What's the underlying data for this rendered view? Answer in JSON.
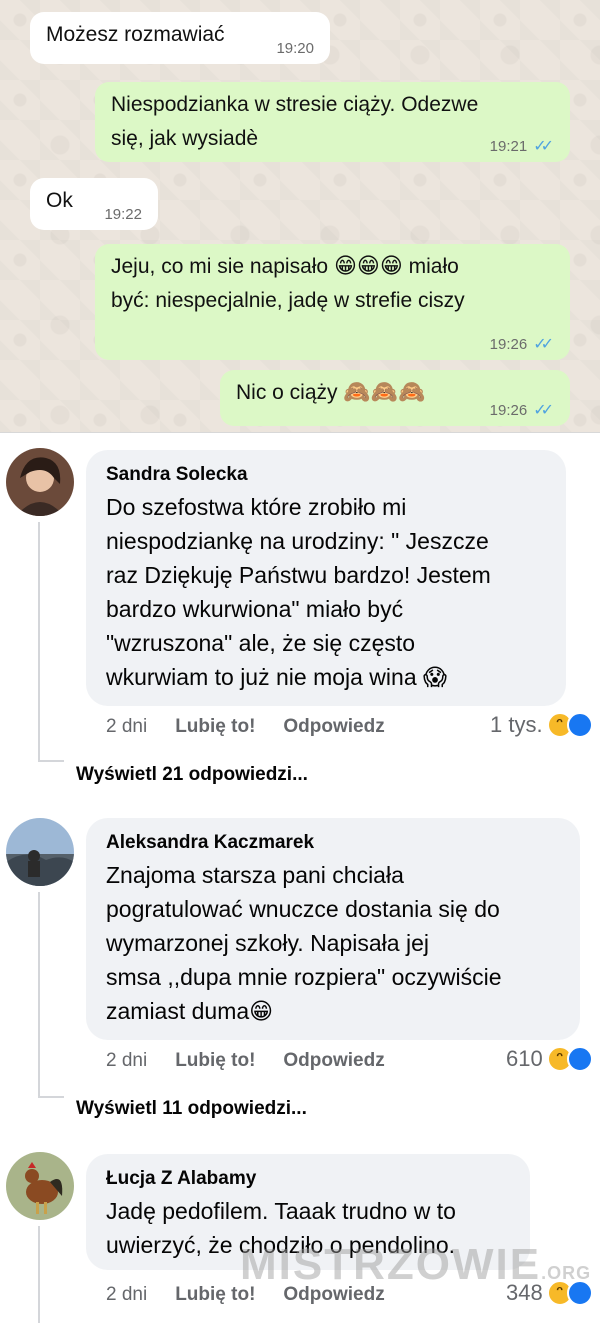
{
  "chat": {
    "messages": [
      {
        "text": "Możesz rozmawiać",
        "time": "19:20",
        "dir": "in"
      },
      {
        "text_line1": "Niespodzianka w stresie ciąży. Odezwe",
        "text_line2": "się, jak wysiadè",
        "time": "19:21",
        "dir": "out"
      },
      {
        "text": "Ok",
        "time": "19:22",
        "dir": "in"
      },
      {
        "text_line1a": "Jeju, co mi sie napisało",
        "emoji1": "😁😁😁",
        "text_line1b": "miało",
        "text_line2": "być: niespecjalnie, jadę w strefie ciszy",
        "time": "19:26",
        "dir": "out"
      },
      {
        "text": "Nic o ciąży",
        "emoji": "🙈🙈🙈",
        "time": "19:26",
        "dir": "out"
      }
    ],
    "read_ticks": "✓✓"
  },
  "comments": [
    {
      "name": "Sandra Solecka",
      "lines": [
        "Do szefostwa które zrobiło mi",
        "niespodziankę na urodziny: \" Jeszcze",
        "raz Dziękuję Państwu bardzo! Jestem",
        "bardzo wkurwiona\" miało być",
        "\"wzruszona\" ale, że się często",
        "wkurwiam to już nie moja wina 😱"
      ],
      "age": "2 dni",
      "like": "Lubię to!",
      "reply": "Odpowiedz",
      "reactions": "1 tys.",
      "view_replies": "Wyświetl 21 odpowiedzi..."
    },
    {
      "name": "Aleksandra Kaczmarek",
      "lines": [
        "Znajoma starsza pani chciała",
        "pogratulować wnuczce dostania się do",
        "wymarzonej szkoły. Napisała jej",
        "smsa ,,dupa mnie rozpiera\" oczywiście",
        "zamiast duma😁"
      ],
      "age": "2 dni",
      "like": "Lubię to!",
      "reply": "Odpowiedz",
      "reactions": "610",
      "view_replies": "Wyświetl 11 odpowiedzi..."
    },
    {
      "name": "Łucja Z Alabamy",
      "lines": [
        "Jadę pedofilem. Taaak trudno w to",
        "uwierzyć, że chodziło o pendolino."
      ],
      "age": "2 dni",
      "like": "Lubię to!",
      "reply": "Odpowiedz",
      "reactions": "348"
    }
  ],
  "watermark": {
    "main": "MISTRZOWIE",
    "suffix": ".ORG"
  },
  "colors": {
    "chat_bg": "#ece5dd",
    "bubble_out": "#dcf8c6",
    "bubble_in": "#ffffff",
    "tick_blue": "#4fa3e0",
    "comment_bg": "#f0f2f5"
  }
}
